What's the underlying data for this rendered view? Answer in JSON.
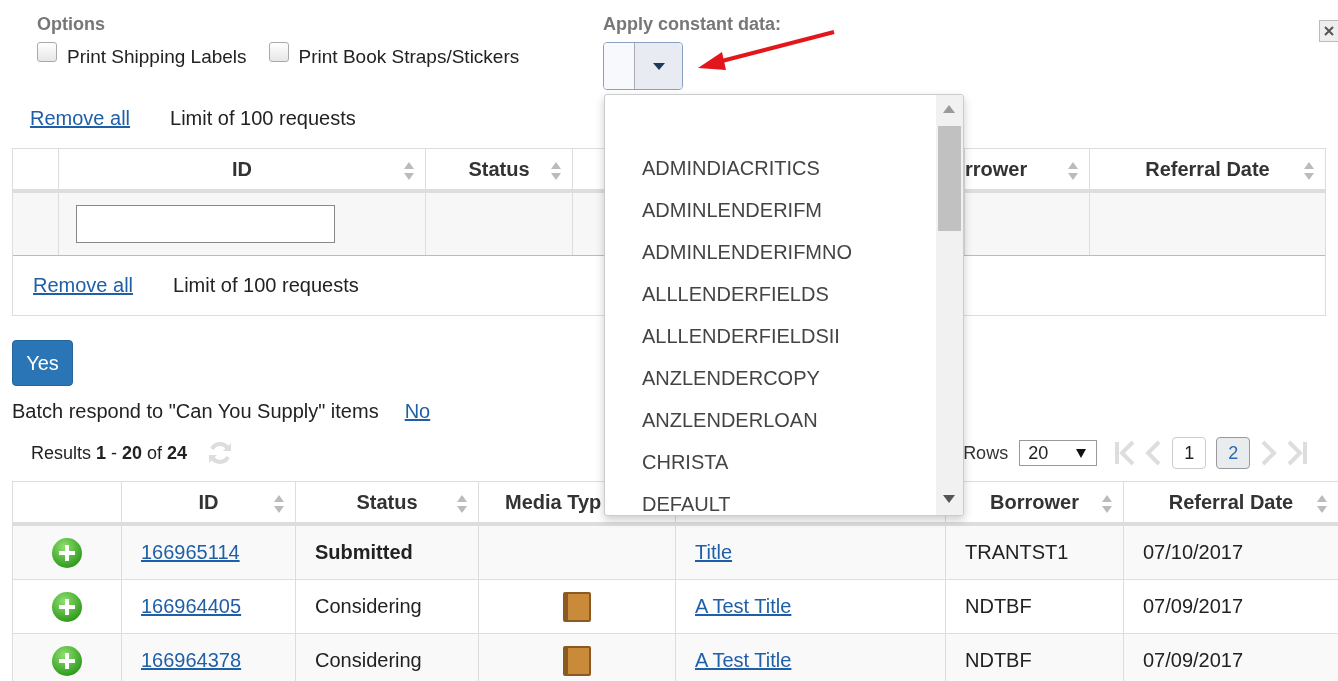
{
  "options": {
    "label": "Options",
    "checkboxes": [
      {
        "label": "Print Shipping Labels",
        "checked": false
      },
      {
        "label": "Print Book Straps/Stickers",
        "checked": false
      }
    ]
  },
  "constant_data": {
    "label": "Apply constant data:",
    "expanded": true,
    "items": [
      "ADMINDIACRITICS",
      "ADMINLENDERIFM",
      "ADMINLENDERIFMNO",
      "ALLLENDERFIELDS",
      "ALLLENDERFIELDSII",
      "ANZLENDERCOPY",
      "ANZLENDERLOAN",
      "CHRISTA",
      "DEFAULT"
    ]
  },
  "request_list": {
    "remove_all": "Remove all",
    "limit": "Limit of 100 requests",
    "columns": [
      "ID",
      "Status",
      "rrower",
      "Referral Date"
    ],
    "footer_remove_all": "Remove all",
    "footer_limit": "Limit of 100 requests"
  },
  "batch": {
    "yes_button": "Yes",
    "text": "Batch respond to \"Can You Supply\" items",
    "no_link": "No"
  },
  "results": {
    "summary": "Results **1** - **20** of **24**",
    "rows_label": "Rows",
    "rows_value": "20",
    "pages": [
      {
        "label": "1",
        "selected": false
      },
      {
        "label": "2",
        "selected": true
      }
    ],
    "nav": [
      {
        "kind": "first",
        "disabled": true
      },
      {
        "kind": "prev",
        "disabled": true
      },
      {
        "kind": "next",
        "disabled": true
      },
      {
        "kind": "last",
        "disabled": true
      }
    ]
  },
  "table": {
    "columns": [
      "ID",
      "Status",
      "Media Typ",
      "Borrower",
      "Referral Date"
    ],
    "rows": [
      {
        "id": "166965114",
        "status": "Submitted",
        "bold": true,
        "media_icon": false,
        "title": "Title",
        "borrower": "TRANTST1",
        "date": "07/10/2017"
      },
      {
        "id": "166964405",
        "status": "Considering",
        "bold": false,
        "media_icon": true,
        "title": "A Test Title",
        "borrower": "NDTBF",
        "date": "07/09/2017"
      },
      {
        "id": "166964378",
        "status": "Considering",
        "bold": false,
        "media_icon": true,
        "title": "A Test Title",
        "borrower": "NDTBF",
        "date": "07/09/2017"
      }
    ]
  }
}
